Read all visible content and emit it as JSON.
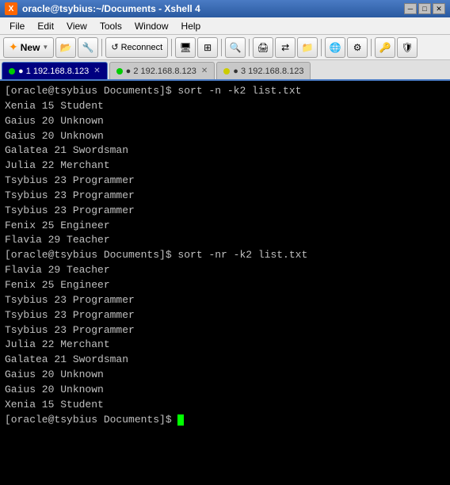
{
  "titlebar": {
    "title": "oracle@tsybius:~/Documents - Xshell 4",
    "icon": "X"
  },
  "menubar": {
    "items": [
      "File",
      "Edit",
      "View",
      "Tools",
      "Window",
      "Help"
    ]
  },
  "toolbar": {
    "new_label": "New",
    "reconnect_label": "Reconnect"
  },
  "tabs": [
    {
      "id": 1,
      "label": "1 192.168.8.123",
      "active": true,
      "dot": "green"
    },
    {
      "id": 2,
      "label": "2 192.168.8.123",
      "active": false,
      "dot": "green"
    },
    {
      "id": 3,
      "label": "3 192.168.8.123",
      "active": false,
      "dot": "yellow"
    }
  ],
  "terminal": {
    "lines": [
      "[oracle@tsybius Documents]$ sort -n -k2 list.txt",
      "Xenia 15 Student",
      "Gaius 20 Unknown",
      "Gaius 20 Unknown",
      "Galatea 21 Swordsman",
      "Julia 22 Merchant",
      "Tsybius 23 Programmer",
      "Tsybius 23 Programmer",
      "Tsybius 23 Programmer",
      "Fenix 25 Engineer",
      "Flavia 29 Teacher",
      "[oracle@tsybius Documents]$ sort -nr -k2 list.txt",
      "Flavia 29 Teacher",
      "Fenix 25 Engineer",
      "Tsybius 23 Programmer",
      "Tsybius 23 Programmer",
      "Tsybius 23 Programmer",
      "Julia 22 Merchant",
      "Galatea 21 Swordsman",
      "Gaius 20 Unknown",
      "Gaius 20 Unknown",
      "Xenia 15 Student",
      "[oracle@tsybius Documents]$ "
    ]
  }
}
